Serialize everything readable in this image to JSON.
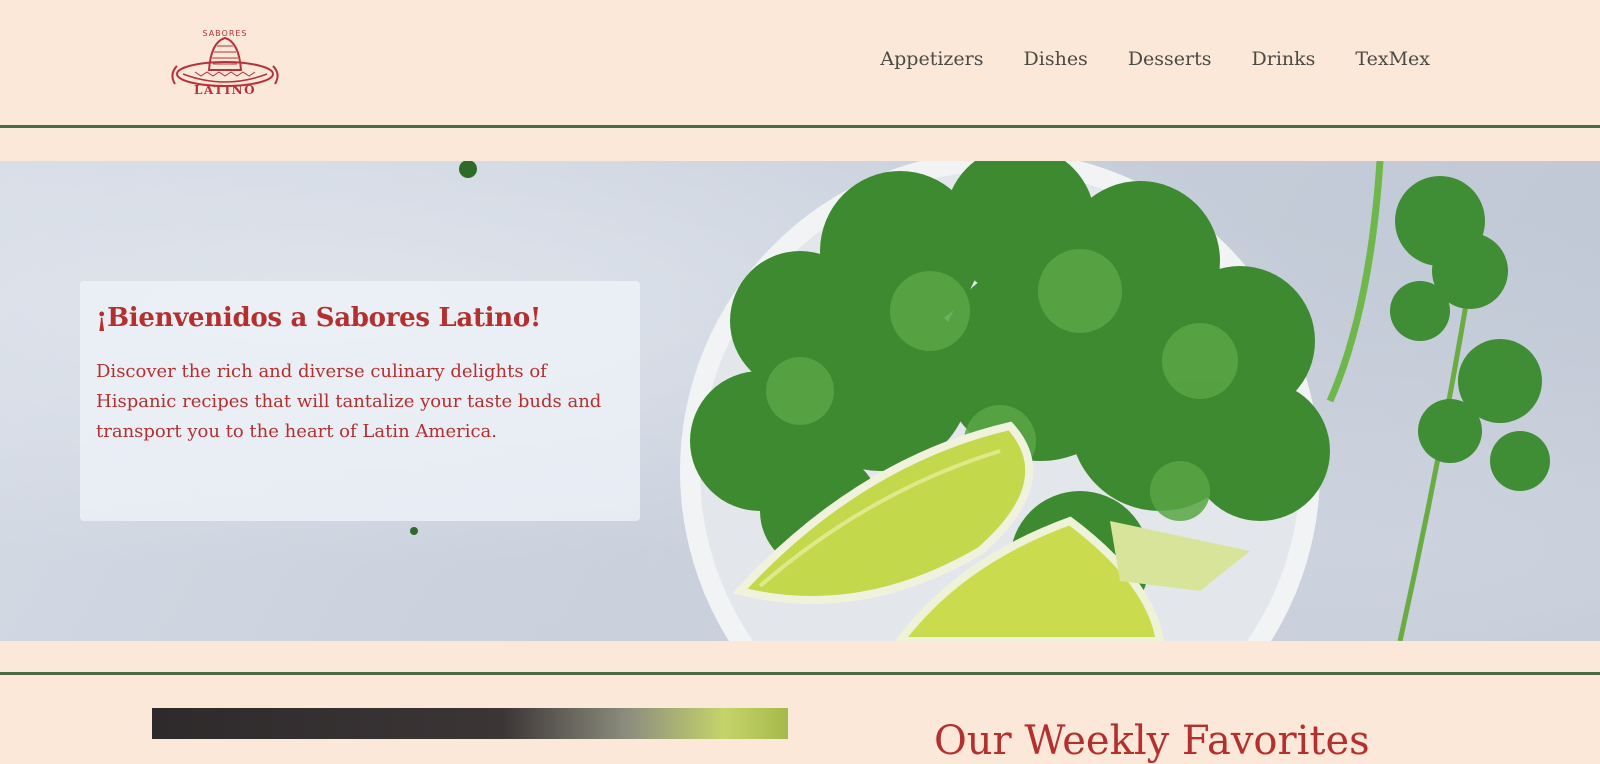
{
  "logo": {
    "top_text": "SABORES",
    "bottom_text": "LATINO",
    "color": "#b4323a"
  },
  "nav": {
    "items": [
      {
        "label": "Appetizers"
      },
      {
        "label": "Dishes"
      },
      {
        "label": "Desserts"
      },
      {
        "label": "Drinks"
      },
      {
        "label": "TexMex"
      }
    ]
  },
  "hero": {
    "title": "¡Bienvenidos a Sabores Latino!",
    "description": "Discover the rich and diverse culinary delights of Hispanic recipes that will tantalize your taste buds and transport you to the heart of Latin America.",
    "image": "cilantro-and-lime-bowl"
  },
  "section": {
    "title": "Our Weekly Favorites"
  },
  "colors": {
    "background": "#fce8d8",
    "accent": "#b3302f",
    "divider": "#4b6b43",
    "nav_text": "#4a4a46"
  }
}
